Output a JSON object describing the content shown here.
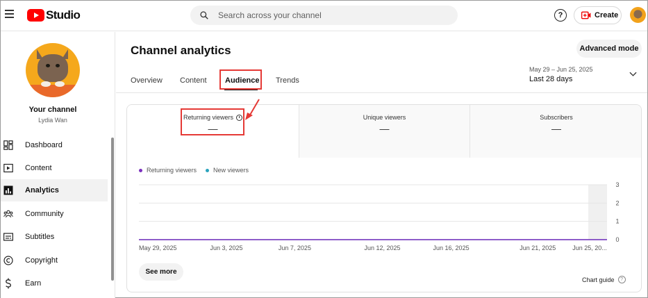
{
  "header": {
    "logo_text": "Studio",
    "search_placeholder": "Search across your channel",
    "help_symbol": "?",
    "create_label": "Create"
  },
  "sidebar": {
    "channel_title": "Your channel",
    "channel_owner": "Lydia Wan",
    "items": [
      {
        "label": "Dashboard",
        "icon": "dashboard-icon"
      },
      {
        "label": "Content",
        "icon": "content-icon"
      },
      {
        "label": "Analytics",
        "icon": "analytics-icon",
        "active": true
      },
      {
        "label": "Community",
        "icon": "community-icon"
      },
      {
        "label": "Subtitles",
        "icon": "subtitles-icon"
      },
      {
        "label": "Copyright",
        "icon": "copyright-icon"
      },
      {
        "label": "Earn",
        "icon": "earn-icon"
      }
    ]
  },
  "main": {
    "title": "Channel analytics",
    "advanced_mode_label": "Advanced mode",
    "tabs": [
      {
        "label": "Overview"
      },
      {
        "label": "Content"
      },
      {
        "label": "Audience",
        "active": true
      },
      {
        "label": "Trends"
      }
    ],
    "date_range": "May 29 – Jun 25, 2025",
    "date_period": "Last 28 days"
  },
  "card": {
    "metrics": [
      {
        "label": "Returning viewers",
        "value": "—"
      },
      {
        "label": "Unique viewers",
        "value": "—"
      },
      {
        "label": "Subscribers",
        "value": "—"
      }
    ],
    "see_more_label": "See more",
    "chart_guide_label": "Chart guide",
    "chart_guide_symbol": "?"
  },
  "chart_data": {
    "type": "line",
    "x_ticks": [
      "May 29, 2025",
      "Jun 3, 2025",
      "Jun 7, 2025",
      "Jun 12, 2025",
      "Jun 16, 2025",
      "Jun 21, 2025",
      "Jun 25, 20..."
    ],
    "y_ticks": [
      0,
      1,
      2,
      3
    ],
    "ylim": [
      0,
      3
    ],
    "x_range": [
      "May 29, 2025",
      "Jun 25, 2025"
    ],
    "grid": true,
    "legend_position": "top-left",
    "series": [
      {
        "name": "Returning viewers",
        "color": "#7b2fbe",
        "values": [
          0,
          0
        ]
      },
      {
        "name": "New viewers",
        "color": "#2aa3bd",
        "values": [
          0,
          0
        ]
      }
    ]
  },
  "colors": {
    "brand_red": "#ff0000",
    "highlight": "#e53935"
  }
}
